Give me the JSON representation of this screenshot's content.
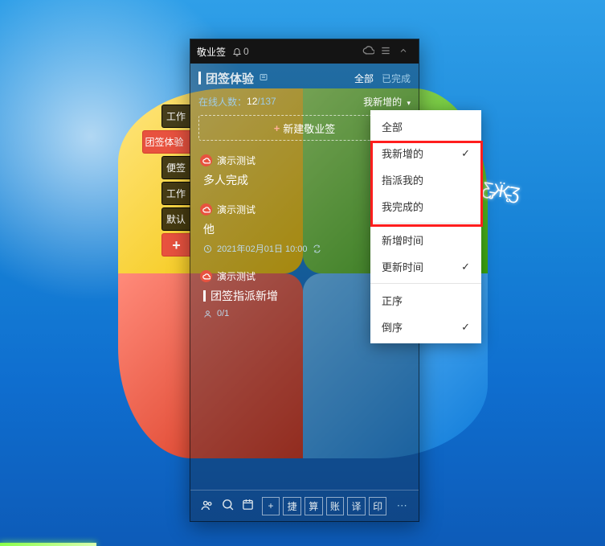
{
  "titlebar": {
    "app_name": "敬业签",
    "bell_count": "0"
  },
  "header": {
    "title": "团签体验",
    "tab_all": "全部",
    "tab_done": "已完成",
    "online_label": "在线人数：",
    "online_now": "12",
    "online_total": "/137",
    "sort_label": "我新增的"
  },
  "new_button": "新建敬业签",
  "side_tabs": [
    "工作",
    "团签体验",
    "便签",
    "工作",
    "默认",
    "+"
  ],
  "items": [
    {
      "author": "演示测试",
      "title": "多人完成"
    },
    {
      "author": "演示测试",
      "title": "他",
      "time": "2021年02月01日 10:00"
    },
    {
      "author": "演示测试",
      "title": "团签指派新增",
      "people": "0/1"
    }
  ],
  "bottom_sq": [
    "捷",
    "算",
    "账",
    "译",
    "印"
  ],
  "menu": {
    "g1": [
      "全部",
      "我新增的",
      "指派我的",
      "我完成的"
    ],
    "g2": [
      "新增时间",
      "更新时间"
    ],
    "g3": [
      "正序",
      "倒序"
    ],
    "selected": {
      "g1": 1,
      "g2": 1,
      "g3": 1
    }
  }
}
